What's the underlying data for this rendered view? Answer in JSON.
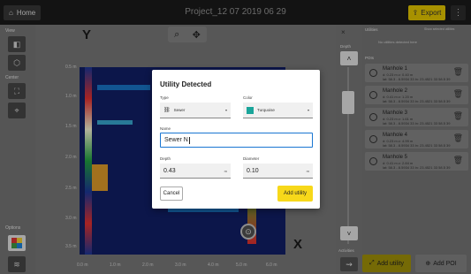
{
  "topbar": {
    "home_label": "Home",
    "project_title": "Project_12 07 2019 06 29",
    "export_label": "Export"
  },
  "left_rail": {
    "view_label": "View",
    "center_label": "Center",
    "options_label": "Options"
  },
  "canvas": {
    "y_axis_title": "Y",
    "x_axis_title": "X",
    "y_ticks": [
      "0.5 m",
      "1.0 m",
      "1.5 m",
      "2.0 m",
      "2.5 m",
      "3.0 m",
      "3.5 m"
    ],
    "x_ticks": [
      "0.0 m",
      "1.0 m",
      "2.0 m",
      "3.0 m",
      "4.0 m",
      "5.0 m",
      "6.0 m"
    ]
  },
  "right_strip": {
    "depth_label": "Depth",
    "activities_label": "Activities"
  },
  "right_panel": {
    "utilities_label": "Utilities",
    "show_all_label": "Show selected utilities",
    "no_utilities": "No utilities detected here",
    "poi_label": "POIs",
    "pois": [
      {
        "name": "Manhole 1",
        "sub1": "d: 0.23 m  z: 0.40 m",
        "sub2": "lat: 58.3 - 8.5934 33  ln: 23.4521 33 58.5 39"
      },
      {
        "name": "Manhole 2",
        "sub1": "d: 0.41 m  z: 1.20 m",
        "sub2": "lat: 58.3 - 8.5934 33  ln: 23.4521 33 58.5 39"
      },
      {
        "name": "Manhole 3",
        "sub1": "d: 0.23 m  z: 1.61 m",
        "sub2": "lat: 58.3 - 8.5934 33  ln: 23.4521 33 58.5 39"
      },
      {
        "name": "Manhole 4",
        "sub1": "d: 0.23 m  z: 4.99 m",
        "sub2": "lat: 58.3 - 8.5934 33  ln: 23.4521 33 58.5 39"
      },
      {
        "name": "Manhole 5",
        "sub1": "d: 0.41 m  z: 2.84 m",
        "sub2": "lat: 58.3 - 8.5934 33  ln: 23.4521 33 58.5 39"
      }
    ],
    "add_utility_label": "Add utility",
    "add_poi_label": "Add POI"
  },
  "dialog": {
    "title": "Utility Detected",
    "type_label": "Type",
    "type_value": "Sewer",
    "color_label": "Color",
    "color_value": "Turquoise",
    "color_hex": "#1aa59a",
    "name_label": "Name",
    "name_value": "Sewer N",
    "depth_label": "Depth",
    "depth_value": "0.43",
    "depth_unit": "m",
    "diameter_label": "Diameter",
    "diameter_value": "0.10",
    "diameter_unit": "m",
    "cancel_label": "Cancel",
    "add_label": "Add utility"
  }
}
